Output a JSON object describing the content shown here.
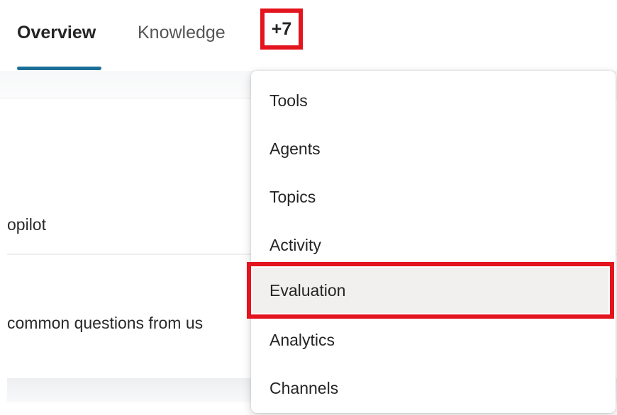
{
  "tabs": {
    "overview_label": "Overview",
    "knowledge_label": "Knowledge",
    "more_label": "+7"
  },
  "background": {
    "copilot_text": "opilot",
    "common_questions_text": "common questions from us"
  },
  "menu": {
    "items": [
      {
        "label": "Tools"
      },
      {
        "label": "Agents"
      },
      {
        "label": "Topics"
      },
      {
        "label": "Activity"
      },
      {
        "label": "Evaluation"
      },
      {
        "label": "Analytics"
      },
      {
        "label": "Channels"
      }
    ],
    "highlighted_index": 4
  },
  "colors": {
    "highlight_border": "#e3141d",
    "tab_underline": "#1b6f98",
    "menu_hover_bg": "#f1f0ee"
  }
}
